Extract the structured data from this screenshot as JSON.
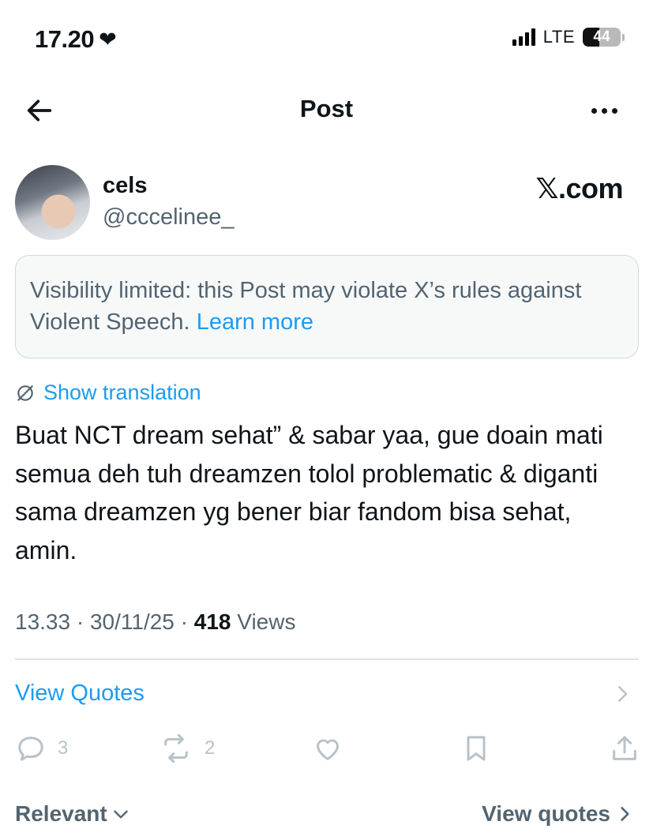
{
  "status_bar": {
    "time": "17.20",
    "network": "LTE",
    "battery": "44",
    "battery_level": 0.44
  },
  "header": {
    "title": "Post"
  },
  "post": {
    "author": {
      "display_name": "cels",
      "handle": "@cccelinee_"
    },
    "watermark": "𝕏.com",
    "notice": {
      "text": "Visibility limited: this Post may violate X’s rules against Violent Speech.",
      "link": "Learn more"
    },
    "translate_label": "Show translation",
    "text": "Buat NCT dream sehat” & sabar yaa, gue doain mati semua deh tuh dreamzen tolol problematic & diganti sama dreamzen yg bener biar fandom bisa sehat, amin.",
    "meta": {
      "time": "13.33",
      "separator": " · ",
      "date": "30/11/25",
      "views_count": "418",
      "views_label": "Views"
    },
    "view_quotes_label": "View Quotes",
    "actions": {
      "reply_count": "3",
      "repost_count": "2"
    }
  },
  "footer": {
    "sort_label": "Relevant",
    "quotes_label": "View quotes"
  },
  "colors": {
    "accent": "#1d9bf0",
    "secondary_text": "#536471",
    "notice_bg": "#f7f9f9"
  }
}
